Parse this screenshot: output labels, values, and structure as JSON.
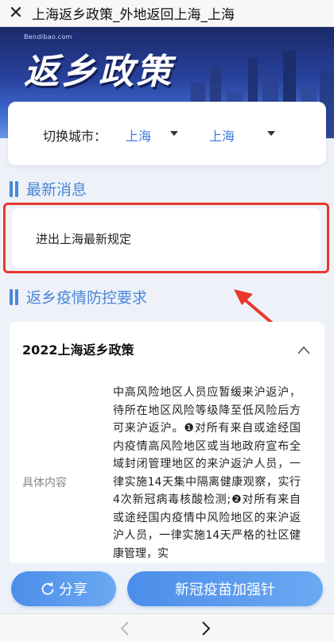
{
  "topbar": {
    "title": "上海返乡政策_外地返回上海_上海"
  },
  "banner": {
    "site": "Bendibao.com",
    "headline": "返乡政策"
  },
  "city_selector": {
    "label": "切换城市：",
    "province": "上海",
    "city": "上海"
  },
  "latest_news": {
    "title": "最新消息",
    "item": "进出上海最新规定"
  },
  "policy_section": {
    "title": "返乡疫情防控要求",
    "card_title": "2022上海返乡政策",
    "content_label": "具体内容",
    "content": "中高风险地区人员应暂缓来沪返沪，待所在地区风险等级降至低风险后方可来沪返沪。❶对所有来自或途经国内疫情高风险地区或当地政府宣布全域封闭管理地区的来沪返沪人员，一律实施14天集中隔离健康观察，实行4次新冠病毒核酸检测;❷对所有来自或途经国内疫情中风险地区的来沪返沪人员，一律实施14天严格的社区健康管理，实"
  },
  "actions": {
    "share": "分享",
    "booster": "新冠疫苗加强针"
  },
  "colors": {
    "accent": "#4a86d8",
    "highlight_red": "#e8372e",
    "button_blue": "#4b8eea"
  },
  "icons": {
    "close": "close-icon",
    "share": "share-icon",
    "chevron_up": "chevron-up-icon",
    "back": "back-icon",
    "forward": "forward-icon"
  }
}
